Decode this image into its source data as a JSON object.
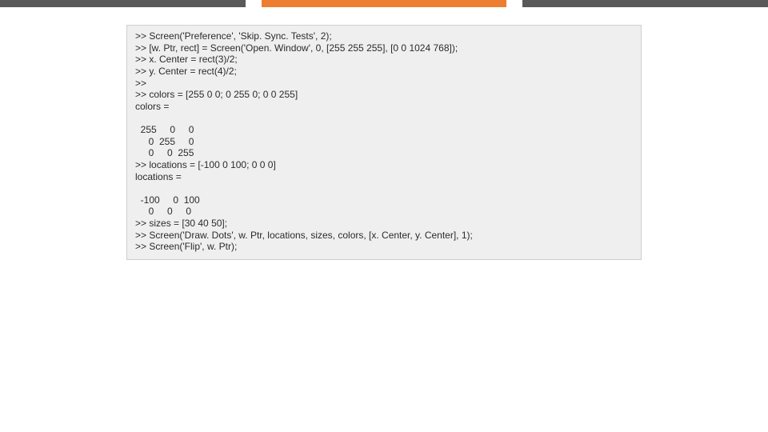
{
  "code": {
    "l01": ">> Screen('Preference', 'Skip. Sync. Tests', 2);",
    "l02": ">> [w. Ptr, rect] = Screen('Open. Window', 0, [255 255 255], [0 0 1024 768]);",
    "l03": ">> x. Center = rect(3)/2;",
    "l04": ">> y. Center = rect(4)/2;",
    "l05": ">>",
    "l06": ">> colors = [255 0 0; 0 255 0; 0 0 255]",
    "l07": "colors =",
    "l08": "  255     0     0",
    "l09": "     0  255     0",
    "l10": "     0     0  255",
    "l11": ">> locations = [-100 0 100; 0 0 0]",
    "l12": "locations =",
    "l13": "  -100     0  100",
    "l14": "     0     0     0",
    "l15": ">> sizes = [30 40 50];",
    "l16": ">> Screen('Draw. Dots', w. Ptr, locations, sizes, colors, [x. Center, y. Center], 1);",
    "l17": ">> Screen('Flip', w. Ptr);"
  }
}
